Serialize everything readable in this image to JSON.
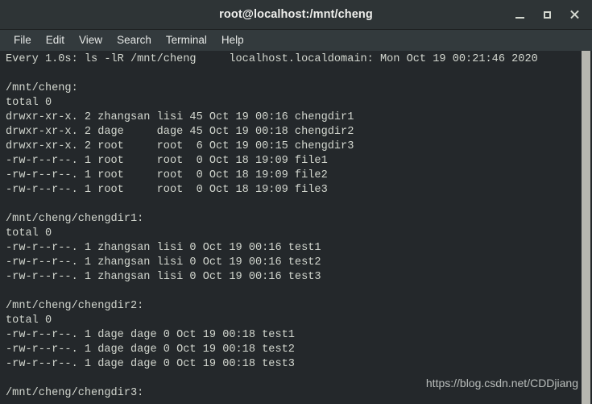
{
  "window": {
    "title": "root@localhost:/mnt/cheng",
    "controls": {
      "minimize_label": "_",
      "maximize_label": "□",
      "close_label": "×"
    },
    "colors": {
      "titlebar_bg": "#2e3436",
      "menubar_bg": "#333a3d",
      "terminal_bg": "#24282b",
      "terminal_fg": "#d3d7cf",
      "scrollbar_thumb": "#b7b7b0"
    }
  },
  "menubar": {
    "items": [
      {
        "label": "File"
      },
      {
        "label": "Edit"
      },
      {
        "label": "View"
      },
      {
        "label": "Search"
      },
      {
        "label": "Terminal"
      },
      {
        "label": "Help"
      }
    ]
  },
  "terminal": {
    "watch_header": {
      "interval": "Every 1.0s:",
      "command": "ls -lR /mnt/cheng",
      "hostname": "localhost.localdomain:",
      "timestamp": "Mon Oct 19 00:21:46 2020"
    },
    "lines": [
      "Every 1.0s: ls -lR /mnt/cheng     localhost.localdomain: Mon Oct 19 00:21:46 2020",
      "",
      "/mnt/cheng:",
      "total 0",
      "drwxr-xr-x. 2 zhangsan lisi 45 Oct 19 00:16 chengdir1",
      "drwxr-xr-x. 2 dage     dage 45 Oct 19 00:18 chengdir2",
      "drwxr-xr-x. 2 root     root  6 Oct 19 00:15 chengdir3",
      "-rw-r--r--. 1 root     root  0 Oct 18 19:09 file1",
      "-rw-r--r--. 1 root     root  0 Oct 18 19:09 file2",
      "-rw-r--r--. 1 root     root  0 Oct 18 19:09 file3",
      "",
      "/mnt/cheng/chengdir1:",
      "total 0",
      "-rw-r--r--. 1 zhangsan lisi 0 Oct 19 00:16 test1",
      "-rw-r--r--. 1 zhangsan lisi 0 Oct 19 00:16 test2",
      "-rw-r--r--. 1 zhangsan lisi 0 Oct 19 00:16 test3",
      "",
      "/mnt/cheng/chengdir2:",
      "total 0",
      "-rw-r--r--. 1 dage dage 0 Oct 19 00:18 test1",
      "-rw-r--r--. 1 dage dage 0 Oct 19 00:18 test2",
      "-rw-r--r--. 1 dage dage 0 Oct 19 00:18 test3",
      "",
      "/mnt/cheng/chengdir3:"
    ]
  },
  "watermark": {
    "text": "https://blog.csdn.net/CDDjiang"
  }
}
